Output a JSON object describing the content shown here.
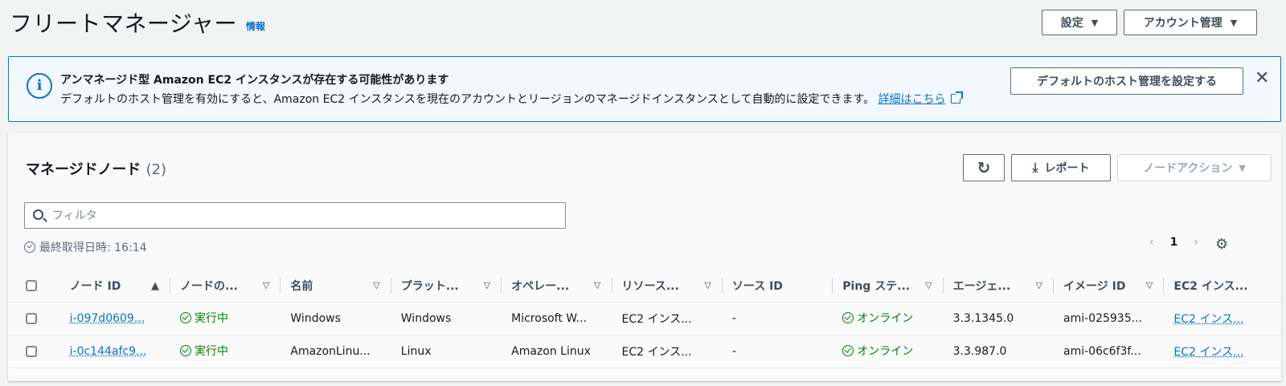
{
  "header": {
    "title": "フリートマネージャー",
    "info": "情報",
    "settings_label": "設定",
    "account_label": "アカウント管理"
  },
  "flash": {
    "title": "アンマネージド型 Amazon EC2 インスタンスが存在する可能性があります",
    "body": "デフォルトのホスト管理を有効にすると、Amazon EC2 インスタンスを現在のアカウントとリージョンのマネージドインスタンスとして自動的に設定できます。",
    "link": "詳細はこちら",
    "button": "デフォルトのホスト管理を設定する"
  },
  "nodes": {
    "title": "マネージドノード",
    "count": "(2)",
    "report_label": "レポート",
    "actions_label": "ノードアクション",
    "filter_placeholder": "フィルタ",
    "last_fetched": "最終取得日時: 16:14",
    "page": "1",
    "columns": [
      "ノード ID",
      "ノードの...",
      "名前",
      "プラット...",
      "オペレー...",
      "リソース...",
      "ソース ID",
      "Ping ステ...",
      "エージェ...",
      "イメージ ID",
      "EC2 インス..."
    ],
    "rows": [
      {
        "node_id": "i-097d0609...",
        "state": "実行中",
        "name": "Windows",
        "platform": "Windows",
        "os": "Microsoft W...",
        "resource": "EC2 インス...",
        "source": "-",
        "ping": "オンライン",
        "agent": "3.3.1345.0",
        "image": "ami-025935...",
        "ec2": "EC2 インス..."
      },
      {
        "node_id": "i-0c144afc9...",
        "state": "実行中",
        "name": "AmazonLinu...",
        "platform": "Linux",
        "os": "Amazon Linux",
        "resource": "EC2 インス...",
        "source": "-",
        "ping": "オンライン",
        "agent": "3.3.987.0",
        "image": "ami-06c6f3f...",
        "ec2": "EC2 インス..."
      }
    ]
  },
  "colors": {
    "link": "#0972d3",
    "success": "#037f0c",
    "info_bg": "#f2f8fd"
  }
}
